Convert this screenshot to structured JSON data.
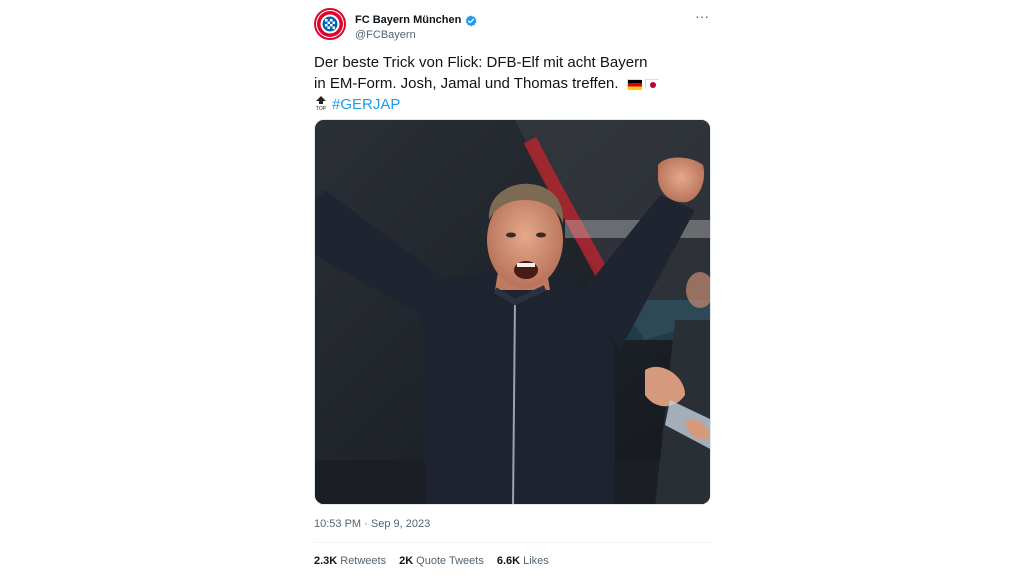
{
  "author": {
    "name": "FC Bayern München",
    "handle": "@FCBayern",
    "verified": true,
    "avatar_icon": "fc-bayern-logo-icon"
  },
  "tweet": {
    "line1": "Der beste Trick von Flick: DFB-Elf mit acht Bayern",
    "line2": "in EM-Form. Josh, Jamal und Thomas treffen.",
    "hashtag": "#GERJAP",
    "media_description_icon": "photo-image"
  },
  "meta": {
    "timestamp": "10:53 PM · Sep 9, 2023"
  },
  "stats": [
    {
      "count": "2.3K",
      "label": "Retweets"
    },
    {
      "count": "2K",
      "label": "Quote Tweets"
    },
    {
      "count": "6.6K",
      "label": "Likes"
    }
  ],
  "colors": {
    "accent": "#1d9bf0",
    "brand": "#dc052d",
    "muted": "#536471"
  },
  "more_icon": "more-options-icon",
  "more_glyph": "···"
}
